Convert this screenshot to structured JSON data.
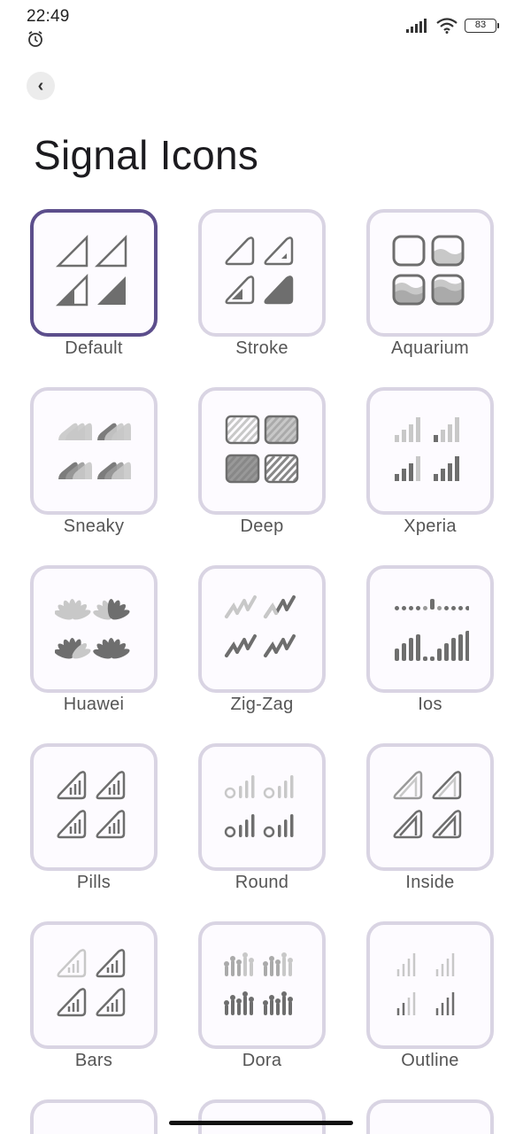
{
  "status_bar": {
    "time": "22:49",
    "battery": "83"
  },
  "header": {
    "back_icon": "chevron-left-icon",
    "title": "Signal Icons"
  },
  "icons": [
    {
      "label": "Default",
      "selected": true
    },
    {
      "label": "Stroke",
      "selected": false
    },
    {
      "label": "Aquarium",
      "selected": false
    },
    {
      "label": "Sneaky",
      "selected": false
    },
    {
      "label": "Deep",
      "selected": false
    },
    {
      "label": "Xperia",
      "selected": false
    },
    {
      "label": "Huawei",
      "selected": false
    },
    {
      "label": "Zig-Zag",
      "selected": false
    },
    {
      "label": "Ios",
      "selected": false
    },
    {
      "label": "Pills",
      "selected": false
    },
    {
      "label": "Round",
      "selected": false
    },
    {
      "label": "Inside",
      "selected": false
    },
    {
      "label": "Bars",
      "selected": false
    },
    {
      "label": "Dora",
      "selected": false
    },
    {
      "label": "Outline",
      "selected": false
    }
  ],
  "colors": {
    "accent": "#5c4e8c",
    "tile_border": "#d9d4e3",
    "icon_dark": "#6e6e6e",
    "icon_light": "#c8c8c8"
  }
}
